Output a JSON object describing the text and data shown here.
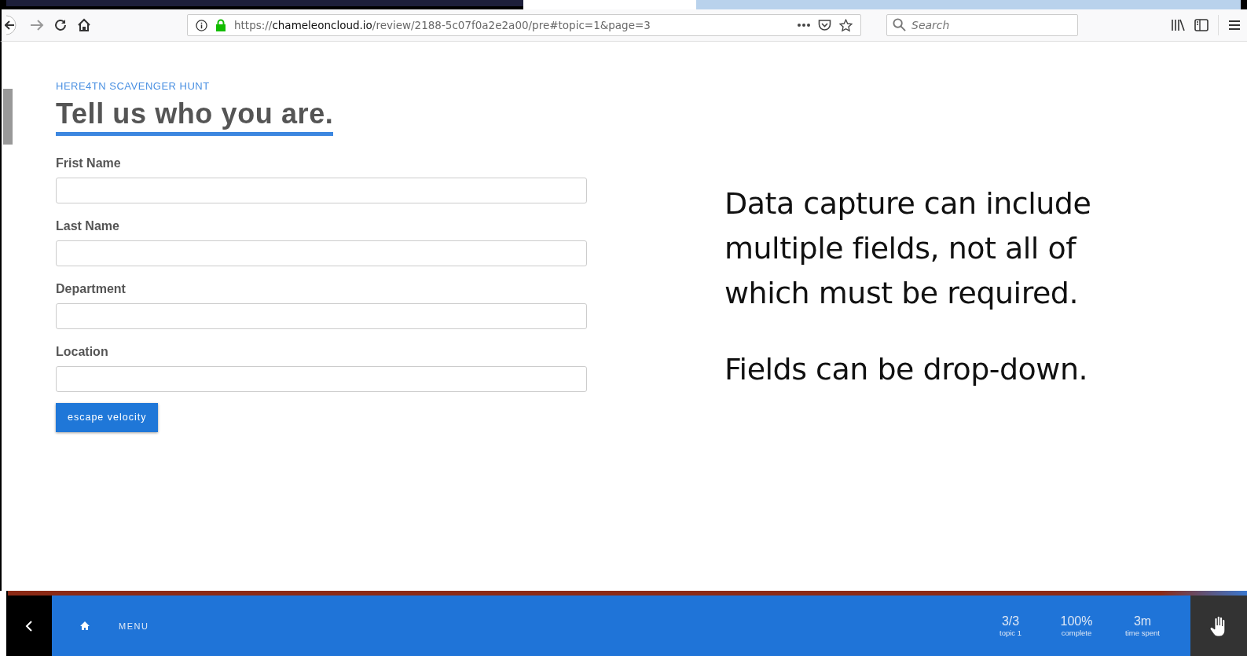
{
  "browser": {
    "url": {
      "scheme": "https://",
      "domain": "chameleoncloud.io",
      "path": "/review/2188-5c07f0a2e2a00/pre#topic=1&page=3"
    },
    "search": {
      "placeholder": "Search"
    }
  },
  "form": {
    "eyebrow": "HERE4TN SCAVENGER HUNT",
    "title": "Tell us who you are.",
    "fields": [
      {
        "label": "Frist Name"
      },
      {
        "label": "Last Name"
      },
      {
        "label": "Department"
      },
      {
        "label": "Location"
      }
    ],
    "submit": "escape velocity"
  },
  "notes": [
    "Data capture can include multiple fields, not all of which must be required.",
    "Fields can be drop-down."
  ],
  "footer": {
    "menu": "MENU",
    "stats": [
      {
        "value": "3/3",
        "caption": "topic 1"
      },
      {
        "value": "100%",
        "caption": "complete"
      },
      {
        "value": "3m",
        "caption": "time spent"
      }
    ]
  }
}
